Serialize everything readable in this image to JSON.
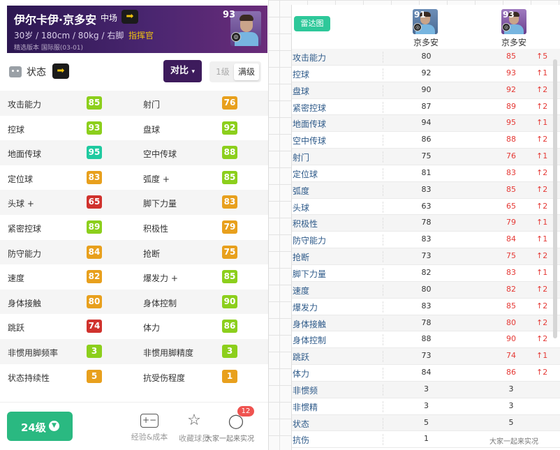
{
  "player": {
    "name": "伊尔卡伊·京多安",
    "position": "中场",
    "arrow": "➡",
    "info": "30岁 / 180cm / 80kg / 右脚",
    "role": "指挥官",
    "version": "精选版本  国际服(03-01)",
    "rating": "93"
  },
  "status": {
    "label": "状态",
    "arrow": "➡",
    "compare_label": "对比",
    "compare_caret": "▾",
    "level_min": "1级",
    "level_max": "满级"
  },
  "stats": [
    {
      "left_name": "攻击能力",
      "left_value": "85",
      "left_color": "#8ccf1c",
      "right_name": "射门",
      "right_value": "76",
      "right_color": "#e8a01d"
    },
    {
      "left_name": "控球",
      "left_value": "93",
      "left_color": "#8ccf1c",
      "right_name": "盘球",
      "right_value": "92",
      "right_color": "#8ccf1c"
    },
    {
      "left_name": "地面传球",
      "left_value": "95",
      "left_color": "#1fcaa0",
      "right_name": "空中传球",
      "right_value": "88",
      "right_color": "#8ccf1c"
    },
    {
      "left_name": "定位球",
      "left_value": "83",
      "left_color": "#e8a01d",
      "right_name": "弧度 +",
      "right_value": "85",
      "right_color": "#8ccf1c"
    },
    {
      "left_name": "头球 +",
      "left_value": "65",
      "left_color": "#d0322d",
      "right_name": "脚下力量",
      "right_value": "83",
      "right_color": "#e8a01d"
    },
    {
      "left_name": "紧密控球",
      "left_value": "89",
      "left_color": "#8ccf1c",
      "right_name": "积极性",
      "right_value": "79",
      "right_color": "#e8a01d"
    },
    {
      "left_name": "防守能力",
      "left_value": "84",
      "left_color": "#e8a01d",
      "right_name": "抢断",
      "right_value": "75",
      "right_color": "#e8a01d"
    },
    {
      "left_name": "速度",
      "left_value": "82",
      "left_color": "#e8a01d",
      "right_name": "爆发力 +",
      "right_value": "85",
      "right_color": "#8ccf1c"
    },
    {
      "left_name": "身体接触",
      "left_value": "80",
      "left_color": "#e8a01d",
      "right_name": "身体控制",
      "right_value": "90",
      "right_color": "#8ccf1c"
    },
    {
      "left_name": "跳跃",
      "left_value": "74",
      "left_color": "#d0322d",
      "right_name": "体力",
      "right_value": "86",
      "right_color": "#8ccf1c"
    },
    {
      "left_name": "非惯用脚频率",
      "left_value": "3",
      "left_color": "#8ccf1c",
      "right_name": "非惯用脚精度",
      "right_value": "3",
      "right_color": "#8ccf1c"
    },
    {
      "left_name": "状态持续性",
      "left_value": "5",
      "left_color": "#e8a01d",
      "right_name": "抗受伤程度",
      "right_value": "1",
      "right_color": "#e8a01d"
    }
  ],
  "bottom": {
    "level_label": "24级",
    "level_chevron": "▼",
    "exp_icon": "+−",
    "exp_label": "经验&成本",
    "favorite_icon": "☆",
    "favorite_label": "收藏球员",
    "comment_icon": "◯",
    "comment_badge": "12",
    "watermark": "大家一起来实况"
  },
  "compare": {
    "radar_label": "雷达图",
    "player_a": {
      "name": "京多安",
      "rating": "91"
    },
    "player_b": {
      "name": "京多安",
      "rating": "93"
    },
    "rows": [
      {
        "name": "攻击能力",
        "a": "80",
        "b": "85",
        "diff": "↑5"
      },
      {
        "name": "控球",
        "a": "92",
        "b": "93",
        "diff": "↑1"
      },
      {
        "name": "盘球",
        "a": "90",
        "b": "92",
        "diff": "↑2"
      },
      {
        "name": "紧密控球",
        "a": "87",
        "b": "89",
        "diff": "↑2"
      },
      {
        "name": "地面传球",
        "a": "94",
        "b": "95",
        "diff": "↑1"
      },
      {
        "name": "空中传球",
        "a": "86",
        "b": "88",
        "diff": "↑2"
      },
      {
        "name": "射门",
        "a": "75",
        "b": "76",
        "diff": "↑1"
      },
      {
        "name": "定位球",
        "a": "81",
        "b": "83",
        "diff": "↑2"
      },
      {
        "name": "弧度",
        "a": "83",
        "b": "85",
        "diff": "↑2"
      },
      {
        "name": "头球",
        "a": "63",
        "b": "65",
        "diff": "↑2"
      },
      {
        "name": "积极性",
        "a": "78",
        "b": "79",
        "diff": "↑1"
      },
      {
        "name": "防守能力",
        "a": "83",
        "b": "84",
        "diff": "↑1"
      },
      {
        "name": "抢断",
        "a": "73",
        "b": "75",
        "diff": "↑2"
      },
      {
        "name": "脚下力量",
        "a": "82",
        "b": "83",
        "diff": "↑1"
      },
      {
        "name": "速度",
        "a": "80",
        "b": "82",
        "diff": "↑2"
      },
      {
        "name": "爆发力",
        "a": "83",
        "b": "85",
        "diff": "↑2"
      },
      {
        "name": "身体接触",
        "a": "78",
        "b": "80",
        "diff": "↑2"
      },
      {
        "name": "身体控制",
        "a": "88",
        "b": "90",
        "diff": "↑2"
      },
      {
        "name": "跳跃",
        "a": "73",
        "b": "74",
        "diff": "↑1"
      },
      {
        "name": "体力",
        "a": "84",
        "b": "86",
        "diff": "↑2"
      },
      {
        "name": "非惯频",
        "a": "3",
        "b": "3",
        "diff": ""
      },
      {
        "name": "非惯精",
        "a": "3",
        "b": "3",
        "diff": ""
      },
      {
        "name": "状态",
        "a": "5",
        "b": "5",
        "diff": ""
      },
      {
        "name": "抗伤",
        "a": "1",
        "b": "",
        "diff": ""
      }
    ],
    "watermark": "大家一起来实况"
  }
}
